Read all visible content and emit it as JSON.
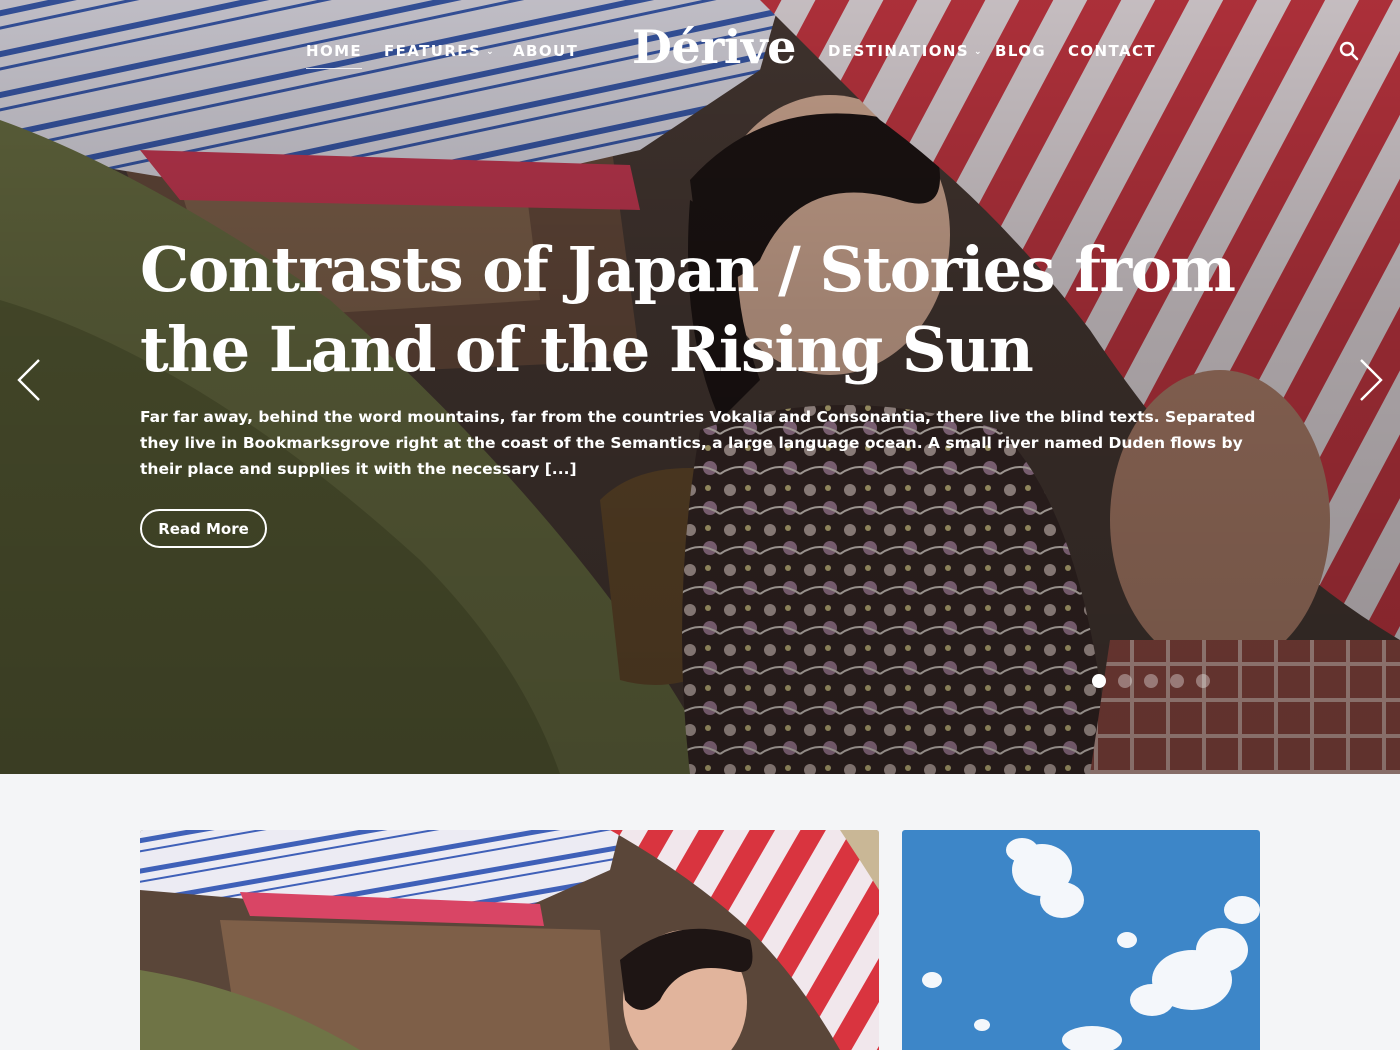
{
  "nav": {
    "left": [
      {
        "label": "HOME",
        "active": true
      },
      {
        "label": "FEATURES",
        "dropdown": true
      },
      {
        "label": "ABOUT"
      }
    ],
    "right": [
      {
        "label": "DESTINATIONS",
        "dropdown": true
      },
      {
        "label": "BLOG"
      },
      {
        "label": "CONTACT"
      }
    ],
    "logo": "Dérive",
    "search_icon": "search-icon"
  },
  "hero": {
    "title": "Contrasts of Japan / Stories from the Land of the Rising Sun",
    "excerpt": "Far far away, behind the word mountains, far from the countries Vokalia and Consonantia, there live the blind texts. Separated they live in Bookmarksgrove right at the coast of the Semantics, a large language ocean. A small river named Duden flows by their place and supplies it with the necessary [...]",
    "button_label": "Read More",
    "slides_total": 5,
    "active_slide": 1,
    "prev_icon": "chevron-left-icon",
    "next_icon": "chevron-right-icon"
  },
  "colors": {
    "page_background": "#f4f5f7",
    "text_on_image": "#ffffff",
    "umbrella_red": "#d9343f",
    "sky_blue": "#3d86c8"
  }
}
